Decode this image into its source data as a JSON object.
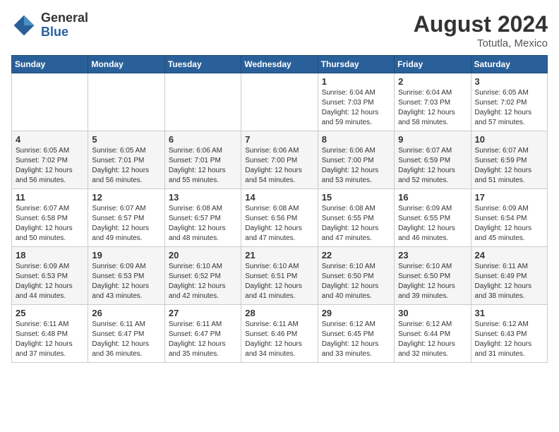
{
  "header": {
    "logo_general": "General",
    "logo_blue": "Blue",
    "month_year": "August 2024",
    "location": "Totutla, Mexico"
  },
  "days_of_week": [
    "Sunday",
    "Monday",
    "Tuesday",
    "Wednesday",
    "Thursday",
    "Friday",
    "Saturday"
  ],
  "weeks": [
    [
      {
        "day": "",
        "info": ""
      },
      {
        "day": "",
        "info": ""
      },
      {
        "day": "",
        "info": ""
      },
      {
        "day": "",
        "info": ""
      },
      {
        "day": "1",
        "info": "Sunrise: 6:04 AM\nSunset: 7:03 PM\nDaylight: 12 hours\nand 59 minutes."
      },
      {
        "day": "2",
        "info": "Sunrise: 6:04 AM\nSunset: 7:03 PM\nDaylight: 12 hours\nand 58 minutes."
      },
      {
        "day": "3",
        "info": "Sunrise: 6:05 AM\nSunset: 7:02 PM\nDaylight: 12 hours\nand 57 minutes."
      }
    ],
    [
      {
        "day": "4",
        "info": "Sunrise: 6:05 AM\nSunset: 7:02 PM\nDaylight: 12 hours\nand 56 minutes."
      },
      {
        "day": "5",
        "info": "Sunrise: 6:05 AM\nSunset: 7:01 PM\nDaylight: 12 hours\nand 56 minutes."
      },
      {
        "day": "6",
        "info": "Sunrise: 6:06 AM\nSunset: 7:01 PM\nDaylight: 12 hours\nand 55 minutes."
      },
      {
        "day": "7",
        "info": "Sunrise: 6:06 AM\nSunset: 7:00 PM\nDaylight: 12 hours\nand 54 minutes."
      },
      {
        "day": "8",
        "info": "Sunrise: 6:06 AM\nSunset: 7:00 PM\nDaylight: 12 hours\nand 53 minutes."
      },
      {
        "day": "9",
        "info": "Sunrise: 6:07 AM\nSunset: 6:59 PM\nDaylight: 12 hours\nand 52 minutes."
      },
      {
        "day": "10",
        "info": "Sunrise: 6:07 AM\nSunset: 6:59 PM\nDaylight: 12 hours\nand 51 minutes."
      }
    ],
    [
      {
        "day": "11",
        "info": "Sunrise: 6:07 AM\nSunset: 6:58 PM\nDaylight: 12 hours\nand 50 minutes."
      },
      {
        "day": "12",
        "info": "Sunrise: 6:07 AM\nSunset: 6:57 PM\nDaylight: 12 hours\nand 49 minutes."
      },
      {
        "day": "13",
        "info": "Sunrise: 6:08 AM\nSunset: 6:57 PM\nDaylight: 12 hours\nand 48 minutes."
      },
      {
        "day": "14",
        "info": "Sunrise: 6:08 AM\nSunset: 6:56 PM\nDaylight: 12 hours\nand 47 minutes."
      },
      {
        "day": "15",
        "info": "Sunrise: 6:08 AM\nSunset: 6:55 PM\nDaylight: 12 hours\nand 47 minutes."
      },
      {
        "day": "16",
        "info": "Sunrise: 6:09 AM\nSunset: 6:55 PM\nDaylight: 12 hours\nand 46 minutes."
      },
      {
        "day": "17",
        "info": "Sunrise: 6:09 AM\nSunset: 6:54 PM\nDaylight: 12 hours\nand 45 minutes."
      }
    ],
    [
      {
        "day": "18",
        "info": "Sunrise: 6:09 AM\nSunset: 6:53 PM\nDaylight: 12 hours\nand 44 minutes."
      },
      {
        "day": "19",
        "info": "Sunrise: 6:09 AM\nSunset: 6:53 PM\nDaylight: 12 hours\nand 43 minutes."
      },
      {
        "day": "20",
        "info": "Sunrise: 6:10 AM\nSunset: 6:52 PM\nDaylight: 12 hours\nand 42 minutes."
      },
      {
        "day": "21",
        "info": "Sunrise: 6:10 AM\nSunset: 6:51 PM\nDaylight: 12 hours\nand 41 minutes."
      },
      {
        "day": "22",
        "info": "Sunrise: 6:10 AM\nSunset: 6:50 PM\nDaylight: 12 hours\nand 40 minutes."
      },
      {
        "day": "23",
        "info": "Sunrise: 6:10 AM\nSunset: 6:50 PM\nDaylight: 12 hours\nand 39 minutes."
      },
      {
        "day": "24",
        "info": "Sunrise: 6:11 AM\nSunset: 6:49 PM\nDaylight: 12 hours\nand 38 minutes."
      }
    ],
    [
      {
        "day": "25",
        "info": "Sunrise: 6:11 AM\nSunset: 6:48 PM\nDaylight: 12 hours\nand 37 minutes."
      },
      {
        "day": "26",
        "info": "Sunrise: 6:11 AM\nSunset: 6:47 PM\nDaylight: 12 hours\nand 36 minutes."
      },
      {
        "day": "27",
        "info": "Sunrise: 6:11 AM\nSunset: 6:47 PM\nDaylight: 12 hours\nand 35 minutes."
      },
      {
        "day": "28",
        "info": "Sunrise: 6:11 AM\nSunset: 6:46 PM\nDaylight: 12 hours\nand 34 minutes."
      },
      {
        "day": "29",
        "info": "Sunrise: 6:12 AM\nSunset: 6:45 PM\nDaylight: 12 hours\nand 33 minutes."
      },
      {
        "day": "30",
        "info": "Sunrise: 6:12 AM\nSunset: 6:44 PM\nDaylight: 12 hours\nand 32 minutes."
      },
      {
        "day": "31",
        "info": "Sunrise: 6:12 AM\nSunset: 6:43 PM\nDaylight: 12 hours\nand 31 minutes."
      }
    ]
  ]
}
